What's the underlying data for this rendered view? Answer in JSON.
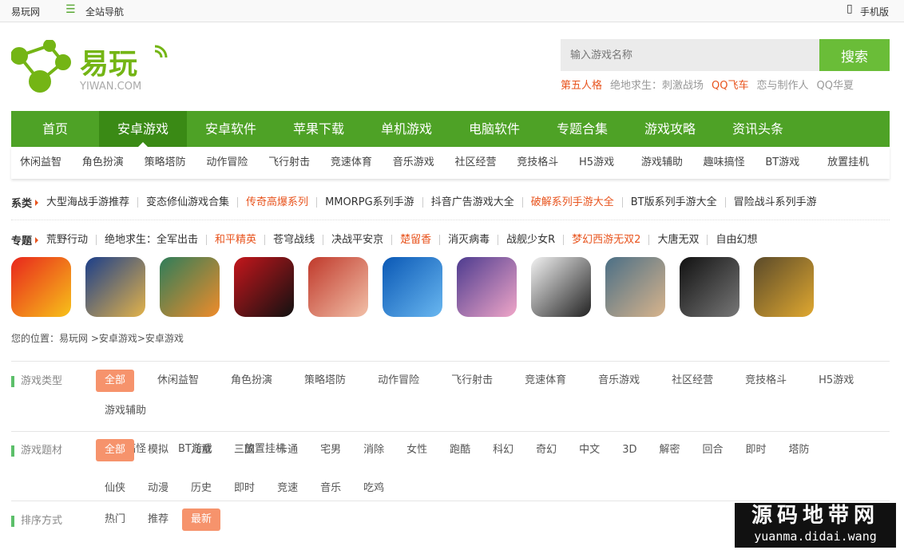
{
  "topbar": {
    "site": "易玩网",
    "nav_all": "全站导航",
    "mobile": "手机版"
  },
  "logo": {
    "text": "易玩",
    "sub": "YIWAN.COM"
  },
  "search": {
    "placeholder": "输入游戏名称",
    "button": "搜索"
  },
  "hot_words": [
    {
      "t": "第五人格",
      "o": true
    },
    {
      "t": "绝地求生：刺激战场",
      "o": false
    },
    {
      "t": "QQ飞车",
      "o": true
    },
    {
      "t": "恋与制作人",
      "o": false
    },
    {
      "t": "QQ华夏",
      "o": false
    }
  ],
  "nav": [
    "首页",
    "安卓游戏",
    "安卓软件",
    "苹果下载",
    "单机游戏",
    "电脑软件",
    "专题合集",
    "游戏攻略",
    "资讯头条"
  ],
  "nav_active": 1,
  "subnav": [
    "休闲益智",
    "角色扮演",
    "策略塔防",
    "动作冒险",
    "飞行射击",
    "竞速体育",
    "音乐游戏",
    "社区经营",
    "竞技格斗",
    "H5游戏",
    "游戏辅助",
    "趣味搞怪",
    "BT游戏",
    "放置挂机"
  ],
  "series": {
    "label": "系类",
    "items": [
      {
        "t": "大型海战手游推荐"
      },
      {
        "t": "变态修仙游戏合集"
      },
      {
        "t": "传奇高爆系列",
        "o": true
      },
      {
        "t": "MMORPG系列手游"
      },
      {
        "t": "抖音广告游戏大全"
      },
      {
        "t": "破解系列手游大全",
        "o": true
      },
      {
        "t": "BT版系列手游大全"
      },
      {
        "t": "冒险战斗系列手游"
      }
    ]
  },
  "topics": {
    "label": "专题",
    "items": [
      {
        "t": "荒野行动"
      },
      {
        "t": "绝地求生：全军出击"
      },
      {
        "t": "和平精英",
        "o": true
      },
      {
        "t": "苍穹战线"
      },
      {
        "t": "决战平安京"
      },
      {
        "t": "楚留香",
        "o": true
      },
      {
        "t": "消灭病毒"
      },
      {
        "t": "战舰少女R"
      },
      {
        "t": "梦幻西游无双2",
        "o": true
      },
      {
        "t": "大唐无双"
      },
      {
        "t": "自由幻想"
      }
    ]
  },
  "game_icons": [
    {
      "c": [
        "#e8261c",
        "#f7c21a"
      ]
    },
    {
      "c": [
        "#1b3e8a",
        "#e3b34a"
      ]
    },
    {
      "c": [
        "#2e7d5a",
        "#f08c2a"
      ]
    },
    {
      "c": [
        "#c4161c",
        "#111111"
      ]
    },
    {
      "c": [
        "#c0392b",
        "#f2c0a8"
      ]
    },
    {
      "c": [
        "#0a58b5",
        "#69b7f0"
      ]
    },
    {
      "c": [
        "#4d3b8f",
        "#f0a6c8"
      ]
    },
    {
      "c": [
        "#f2f2f2",
        "#222222"
      ]
    },
    {
      "c": [
        "#4b6f86",
        "#d8b48c"
      ]
    },
    {
      "c": [
        "#111111",
        "#777777"
      ]
    },
    {
      "c": [
        "#5a4a2a",
        "#e0a830"
      ]
    }
  ],
  "breadcrumb": "您的位置：易玩网 >安卓游戏>安卓游戏",
  "filters": [
    {
      "label": "游戏类型",
      "options": [
        "全部",
        "休闲益智",
        "角色扮演",
        "策略塔防",
        "动作冒险",
        "飞行射击",
        "竞速体育",
        "音乐游戏",
        "社区经营",
        "竞技格斗",
        "H5游戏",
        "游戏辅助",
        "趣味搞怪",
        "BT游戏",
        "放置挂机"
      ],
      "selected": 0
    },
    {
      "label": "游戏题材",
      "options": [
        "全部",
        "模拟",
        "儿童",
        "三国",
        "卡通",
        "宅男",
        "消除",
        "女性",
        "跑酷",
        "科幻",
        "奇幻",
        "中文",
        "3D",
        "解密",
        "回合",
        "即时",
        "塔防",
        "仙侠",
        "动漫",
        "历史",
        "即时",
        "竞速",
        "音乐",
        "吃鸡"
      ],
      "selected": 0
    },
    {
      "label": "排序方式",
      "options": [
        "热门",
        "推荐",
        "最新"
      ],
      "selected": 2
    }
  ],
  "watermark": {
    "line1": "源码地带网",
    "line2": "yuanma.didai.wang"
  },
  "colors": {
    "green": "#4ea226",
    "green_active": "#3a8a15",
    "search_button": "#6abd38",
    "orange": "#e8541e",
    "selected": "#f6936c"
  }
}
